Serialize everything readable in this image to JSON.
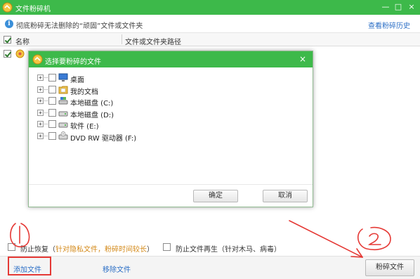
{
  "window": {
    "title": "文件粉碎机",
    "controls": {
      "minimize": "—",
      "maximize": "□",
      "close": "×"
    }
  },
  "info_bar": {
    "icon": "info-icon",
    "text": "彻底粉碎无法删除的“顽固”文件或文件夹",
    "history_link": "查看粉碎历史"
  },
  "table": {
    "columns": [
      "名称",
      "文件或文件夹路径"
    ]
  },
  "dialog": {
    "title": "选择要粉碎的文件",
    "close": "×",
    "tree": [
      {
        "label": "桌面",
        "icon": "desktop-icon"
      },
      {
        "label": "我的文档",
        "icon": "documents-folder-icon"
      },
      {
        "label": "本地磁盘 (C:)",
        "icon": "system-drive-icon"
      },
      {
        "label": "本地磁盘 (D:)",
        "icon": "drive-icon"
      },
      {
        "label": "软件 (E:)",
        "icon": "drive-icon"
      },
      {
        "label": "DVD RW 驱动器 (F:)",
        "icon": "dvd-drive-icon"
      }
    ],
    "expander": "+",
    "ok_label": "确定",
    "cancel_label": "取消"
  },
  "options": {
    "opt1_label": "防止恢复",
    "opt1_hint": "针对隐私文件，粉碎时间较长",
    "opt1_open": "（",
    "opt1_close": "）",
    "opt2_label": "防止文件再生",
    "opt2_hint": "（针对木马、病毒）"
  },
  "bottom": {
    "add_file": "添加文件",
    "remove_file": "移除文件",
    "shred": "粉碎文件"
  },
  "colors": {
    "accent_green": "#3db94a",
    "link_blue": "#2c6fc6",
    "annotation_red": "#e53935",
    "hint_orange": "#d48a1a"
  }
}
